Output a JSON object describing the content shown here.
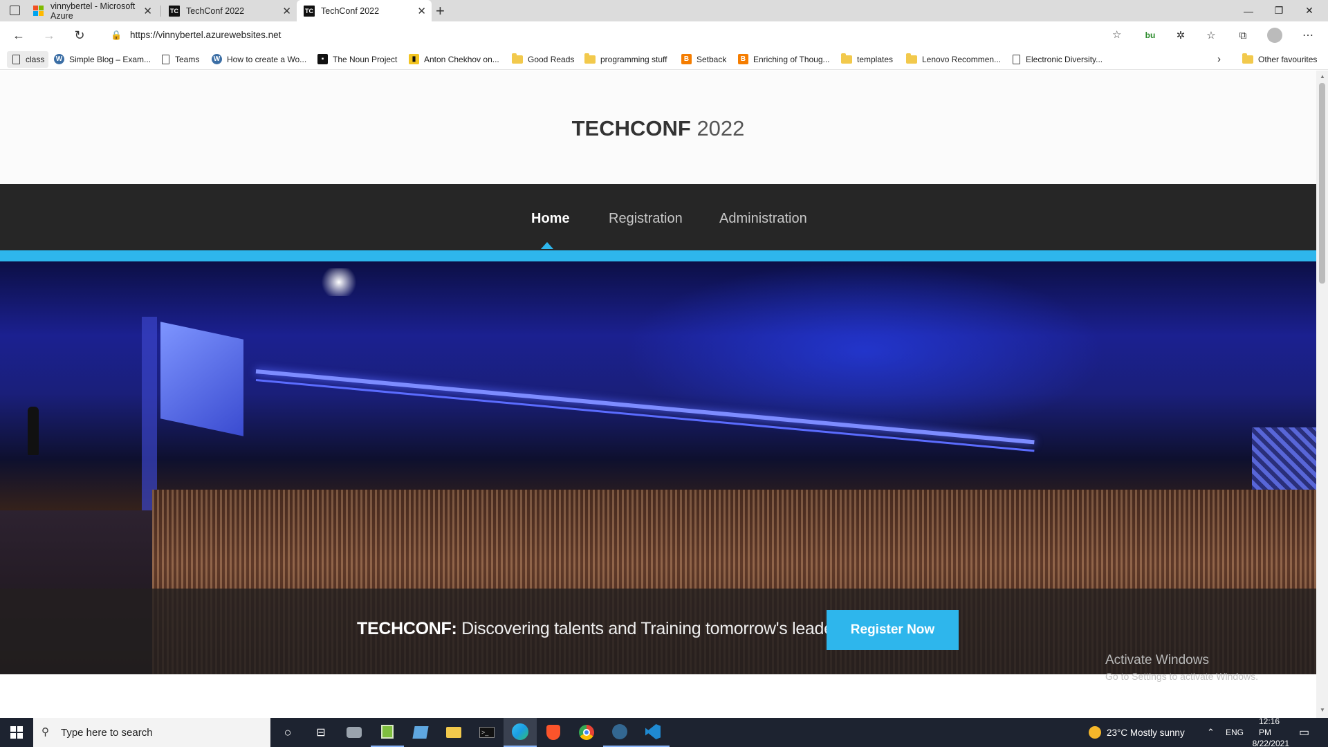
{
  "tabs": [
    {
      "title": "vinnybertel - Microsoft Azure"
    },
    {
      "title": "TechConf 2022"
    },
    {
      "title": "TechConf 2022"
    }
  ],
  "tab_favicon_tc": "TC",
  "address": {
    "url": "https://vinnybertel.azurewebsites.net"
  },
  "bookmarks": [
    {
      "label": "class"
    },
    {
      "label": "Simple Blog – Exam..."
    },
    {
      "label": "Teams"
    },
    {
      "label": "How to create a Wo..."
    },
    {
      "label": "The Noun Project"
    },
    {
      "label": "Anton Chekhov on..."
    },
    {
      "label": "Good Reads"
    },
    {
      "label": "programming stuff"
    },
    {
      "label": "Setback"
    },
    {
      "label": "Enriching of Thoug..."
    },
    {
      "label": "templates"
    },
    {
      "label": "Lenovo Recommen..."
    },
    {
      "label": "Electronic Diversity..."
    },
    {
      "label": "Other favourites"
    }
  ],
  "site": {
    "brand_bold": "TECHCONF",
    "brand_year": "2022",
    "nav": [
      {
        "label": "Home",
        "active": true
      },
      {
        "label": "Registration",
        "active": false
      },
      {
        "label": "Administration",
        "active": false
      }
    ],
    "hero": {
      "tag_bold": "TECHCONF:",
      "tag_text": " Discovering talents and Training tomorrow's leaders",
      "cta": "Register Now"
    },
    "accent_color": "#2eb6ec"
  },
  "watermark": {
    "line1": "Activate Windows",
    "line2": "Go to Settings to activate Windows."
  },
  "taskbar": {
    "search_placeholder": "Type here to search",
    "weather": "23°C  Mostly sunny",
    "lang": "ENG",
    "time": "12:16 PM",
    "date": "8/22/2021"
  }
}
